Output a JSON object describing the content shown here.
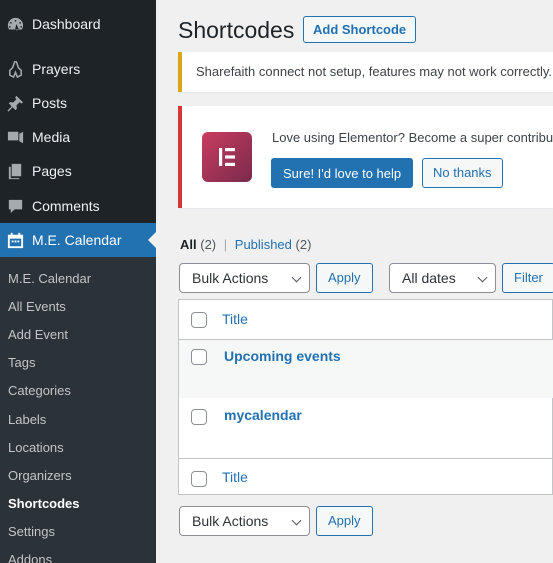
{
  "sidebar": {
    "items": [
      {
        "label": "Dashboard",
        "icon": "dashboard-icon"
      },
      {
        "label": "Prayers",
        "icon": "prayers-icon"
      },
      {
        "label": "Posts",
        "icon": "pushpin-icon"
      },
      {
        "label": "Media",
        "icon": "media-icon"
      },
      {
        "label": "Pages",
        "icon": "pages-icon"
      },
      {
        "label": "Comments",
        "icon": "comment-icon"
      },
      {
        "label": "M.E. Calendar",
        "icon": "calendar-icon"
      }
    ],
    "submenu": [
      "M.E. Calendar",
      "All Events",
      "Add Event",
      "Tags",
      "Categories",
      "Labels",
      "Locations",
      "Organizers",
      "Shortcodes",
      "Settings",
      "Addons"
    ],
    "current_submenu": "Shortcodes"
  },
  "header": {
    "title": "Shortcodes",
    "add_button": "Add Shortcode"
  },
  "notices": {
    "warning": "Sharefaith connect not setup, features may not work correctly.",
    "elementor": {
      "text": "Love using Elementor? Become a super contributor",
      "yes_button": "Sure! I'd love to help",
      "no_button": "No thanks"
    }
  },
  "filters": {
    "all_label": "All",
    "all_count": "(2)",
    "separator": "|",
    "published_label": "Published",
    "published_count": "(2)"
  },
  "toolbar": {
    "bulk_actions": "Bulk Actions",
    "apply": "Apply",
    "dates": "All dates",
    "filter": "Filter"
  },
  "table": {
    "column_title": "Title",
    "rows": [
      {
        "title": "Upcoming events"
      },
      {
        "title": "mycalendar"
      }
    ]
  },
  "colors": {
    "sidebar_bg": "#1d2327",
    "accent": "#2271b1",
    "warning": "#dba617",
    "error": "#d63638"
  }
}
